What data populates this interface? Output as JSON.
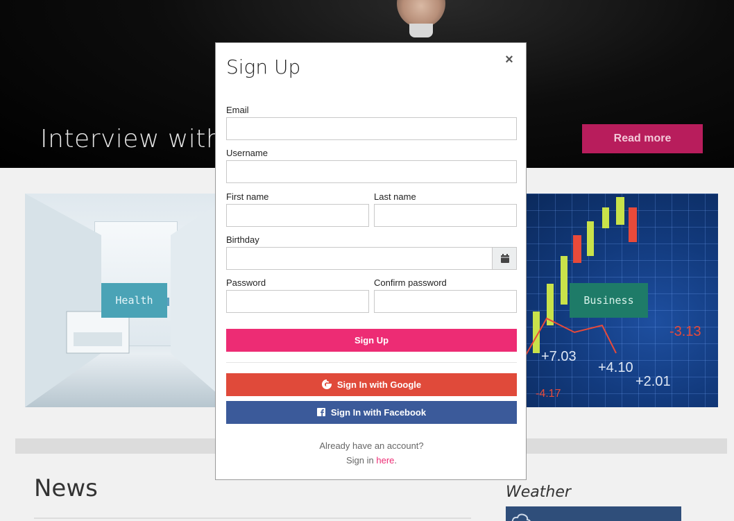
{
  "hero": {
    "title": "Interview with T",
    "read_more_label": "Read more"
  },
  "cards": {
    "health_label": "Health",
    "business_label": "Business",
    "business_numbers": [
      "-3.13",
      "+7.03",
      "+4.10",
      "+2.01",
      "-4.17"
    ]
  },
  "news": {
    "title": "News"
  },
  "weather": {
    "title": "Weather"
  },
  "modal": {
    "title": "Sign Up",
    "close_glyph": "×",
    "fields": {
      "email_label": "Email",
      "username_label": "Username",
      "first_name_label": "First name",
      "last_name_label": "Last name",
      "birthday_label": "Birthday",
      "password_label": "Password",
      "confirm_password_label": "Confirm password"
    },
    "signup_button": "Sign Up",
    "google_button": "Sign In with Google",
    "facebook_button": "Sign In with Facebook",
    "footer": {
      "line1": "Already have an account?",
      "line2_prefix": "Sign in ",
      "line2_link": "here",
      "line2_suffix": "."
    }
  },
  "colors": {
    "accent_pink": "#ed2c74",
    "google_red": "#e04a3a",
    "facebook_blue": "#3b5a9a",
    "read_more": "#b81d5c"
  }
}
